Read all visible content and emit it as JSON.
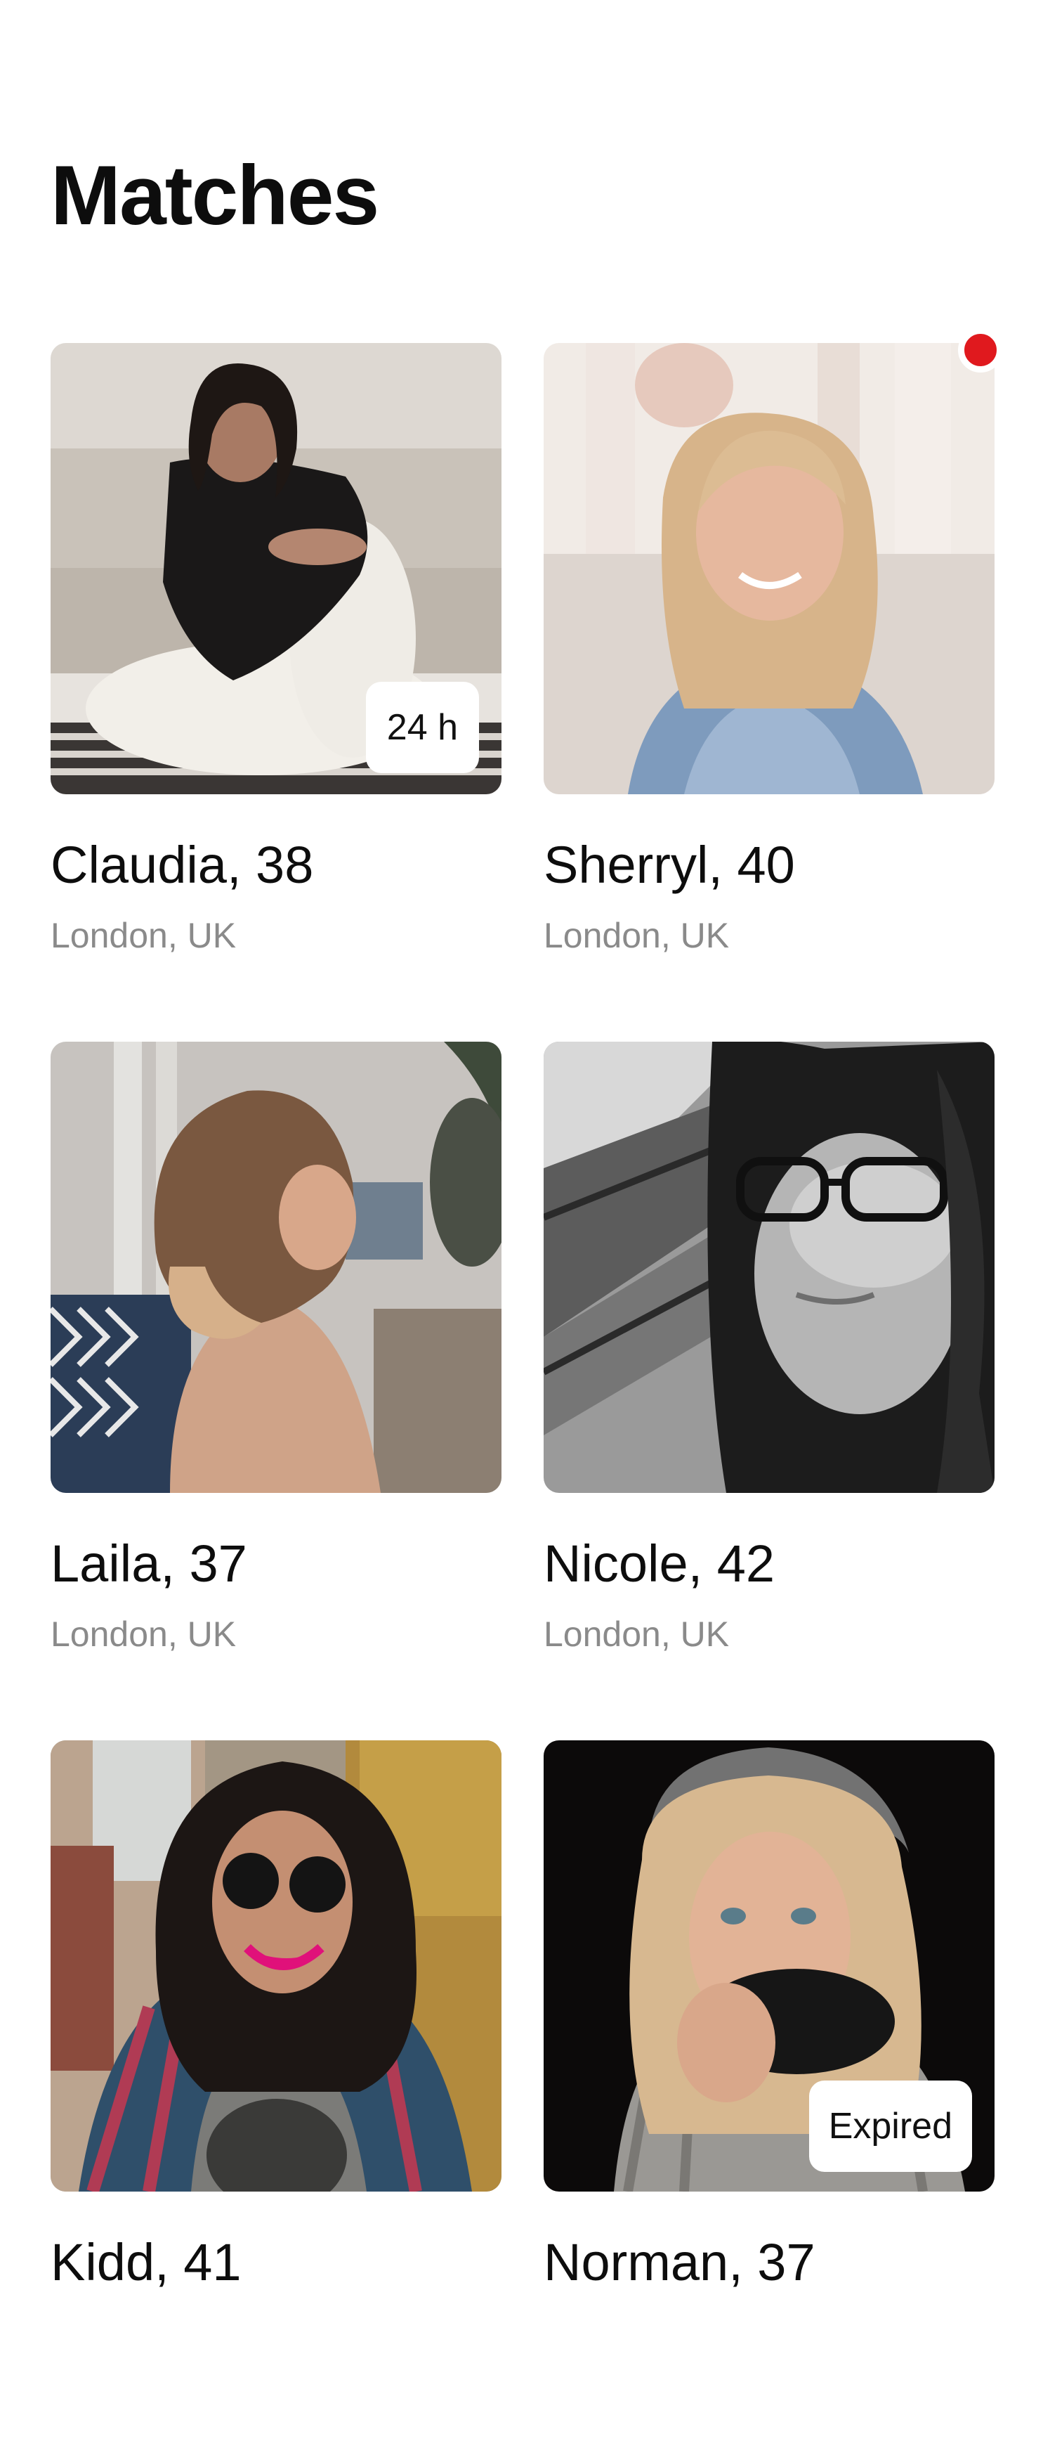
{
  "page": {
    "title": "Matches"
  },
  "colors": {
    "unread_dot": "#e0191e",
    "secondary_text": "#8a8a8a",
    "badge_background": "#ffffff"
  },
  "matches": [
    {
      "name": "Claudia, 38",
      "location": "London, UK",
      "badge": "24 h",
      "unread": false
    },
    {
      "name": "Sherryl, 40",
      "location": "London, UK",
      "badge": "",
      "unread": true
    },
    {
      "name": "Laila, 37",
      "location": "London, UK",
      "badge": "",
      "unread": false
    },
    {
      "name": "Nicole, 42",
      "location": "London, UK",
      "badge": "",
      "unread": false
    },
    {
      "name": "Kidd, 41",
      "location": "",
      "badge": "",
      "unread": false
    },
    {
      "name": "Norman, 37",
      "location": "",
      "badge": "Expired",
      "unread": false
    }
  ]
}
